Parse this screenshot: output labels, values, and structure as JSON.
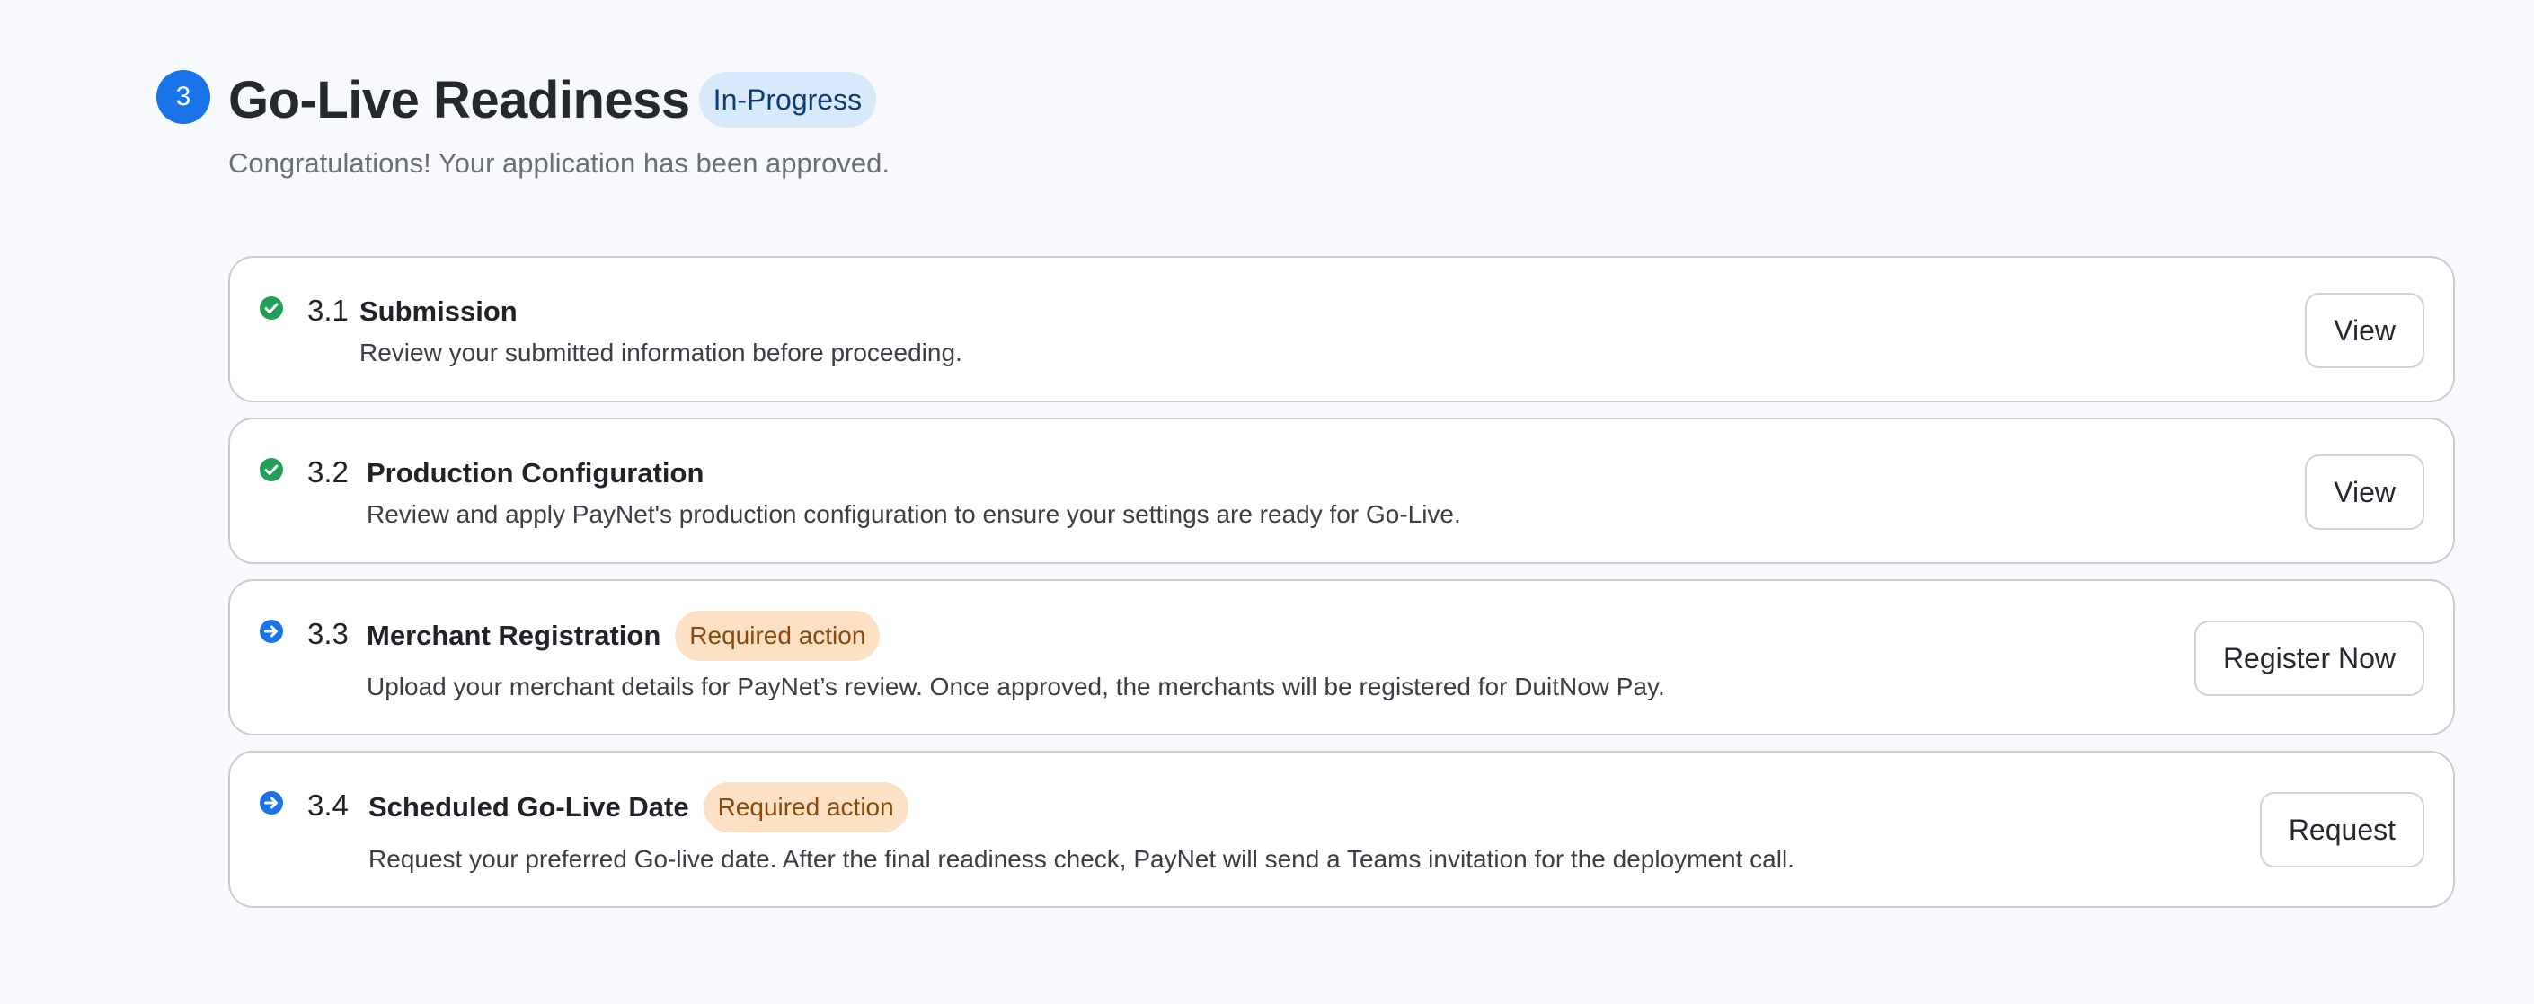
{
  "section": {
    "step_number": "3",
    "title": "Go-Live Readiness",
    "status": "In-Progress",
    "subtitle": "Congratulations! Your application has been approved."
  },
  "colors": {
    "primary": "#1a73e8",
    "success": "#22a05a",
    "required_badge_bg": "#fde1c4",
    "required_badge_text": "#8a4a0c",
    "status_pill_bg": "#d7e9fb"
  },
  "steps": [
    {
      "number": "3.1",
      "title": "Submission",
      "description": "Review your submitted information before proceeding.",
      "status_icon": "check-circle-icon",
      "button": "View"
    },
    {
      "number": "3.2",
      "title": "Production Configuration",
      "description": "Review and apply PayNet's production configuration to ensure your settings are ready for Go-Live.",
      "status_icon": "check-circle-icon",
      "button": "View"
    },
    {
      "number": "3.3",
      "title": "Merchant Registration",
      "badge": "Required action",
      "description": "Upload your merchant details for PayNet’s review. Once approved, the merchants will be registered for DuitNow Pay.",
      "status_icon": "arrow-right-circle-icon",
      "button": "Register Now"
    },
    {
      "number": "3.4",
      "title": "Scheduled Go-Live Date",
      "badge": "Required action",
      "description": "Request your preferred Go-live date. After the final readiness check, PayNet will send a Teams invitation for the deployment call.",
      "status_icon": "arrow-right-circle-icon",
      "button": "Request"
    }
  ]
}
